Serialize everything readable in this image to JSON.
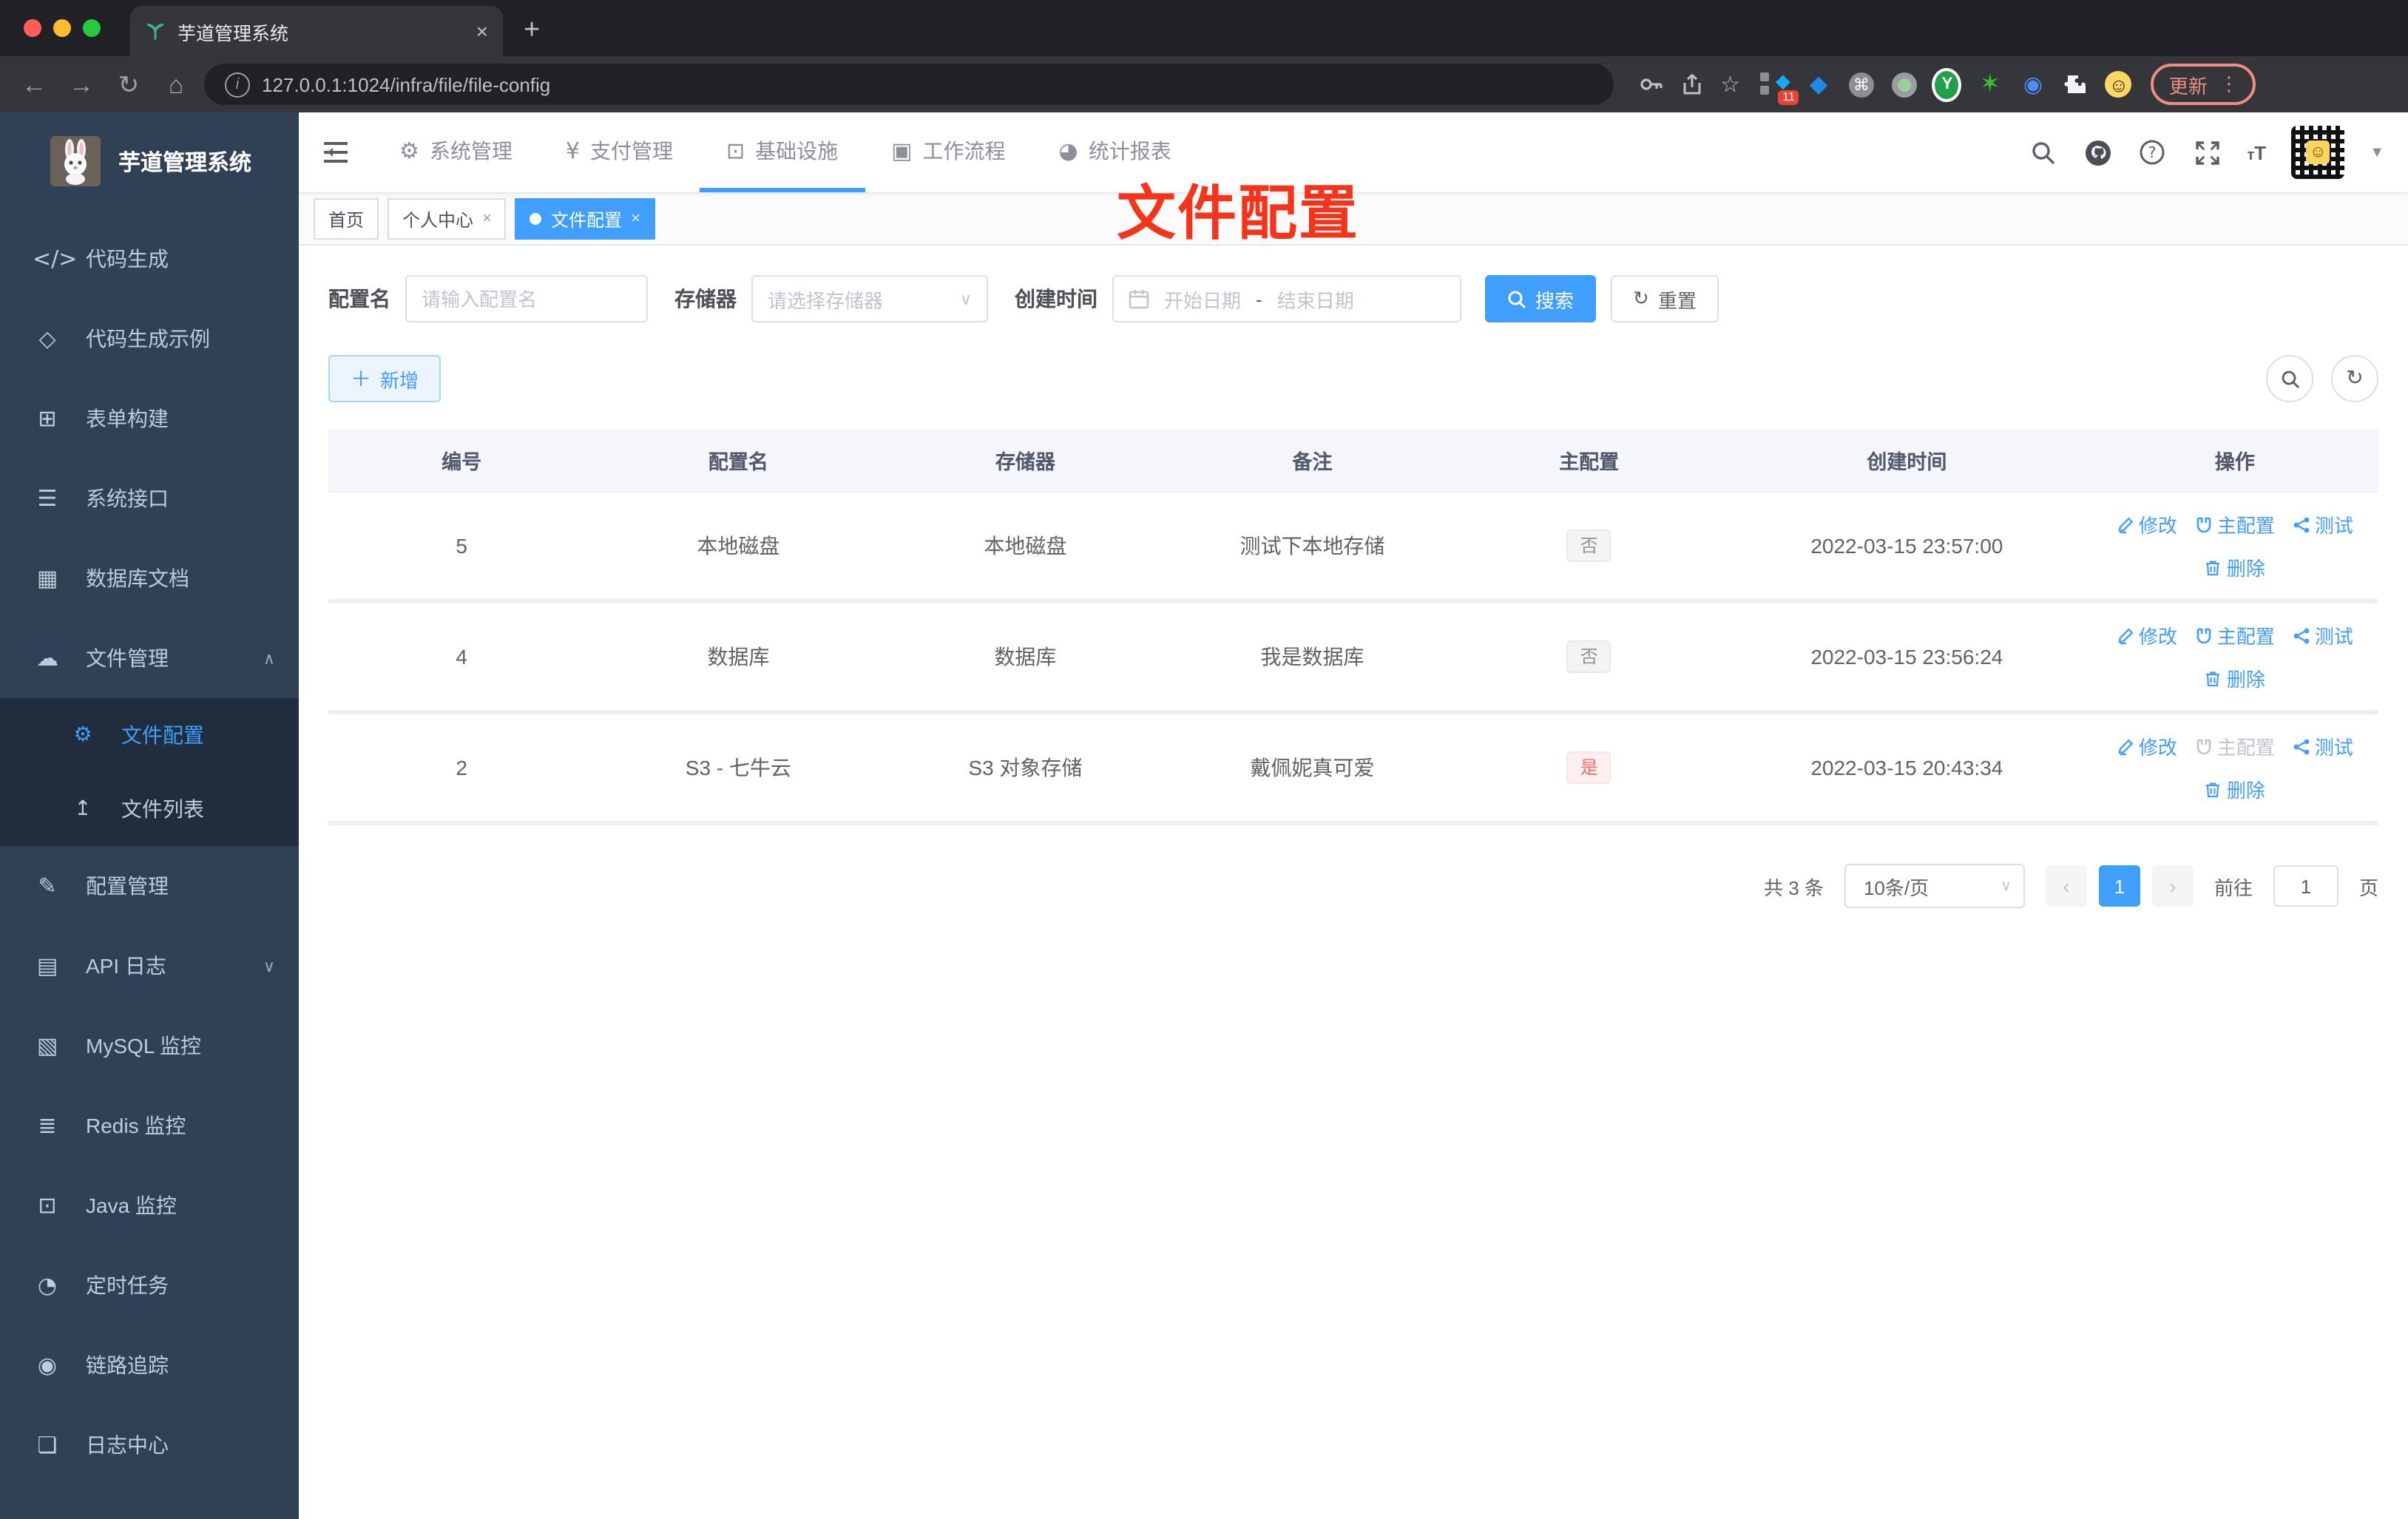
{
  "browser": {
    "tab_title": "芋道管理系统",
    "tab_close": "×",
    "new_tab": "+",
    "url": "127.0.0.1:1024/infra/file/file-config",
    "ext_badge": "11",
    "update_label": "更新",
    "menu_dots": "⋮"
  },
  "app": {
    "brand": "芋道管理系统",
    "overlay_title": "文件配置",
    "topnav": [
      {
        "icon": "gear-icon",
        "label": "系统管理",
        "active": false
      },
      {
        "icon": "yen-icon",
        "label": "支付管理",
        "active": false
      },
      {
        "icon": "monitor-icon",
        "label": "基础设施",
        "active": true
      },
      {
        "icon": "briefcase-icon",
        "label": "工作流程",
        "active": false
      },
      {
        "icon": "dashboard-icon",
        "label": "统计报表",
        "active": false
      }
    ],
    "tabs": [
      {
        "label": "首页",
        "closable": false,
        "active": false
      },
      {
        "label": "个人中心",
        "closable": true,
        "active": false
      },
      {
        "label": "文件配置",
        "closable": true,
        "active": true
      }
    ],
    "tab_close_glyph": "×"
  },
  "sidebar": {
    "items": [
      {
        "icon": "code-icon",
        "label": "代码生成",
        "child": false
      },
      {
        "icon": "shield-icon",
        "label": "代码生成示例",
        "child": false
      },
      {
        "icon": "form-icon",
        "label": "表单构建",
        "child": false
      },
      {
        "icon": "sliders-icon",
        "label": "系统接口",
        "child": false
      },
      {
        "icon": "table-icon",
        "label": "数据库文档",
        "child": false
      },
      {
        "icon": "cloud-download-icon",
        "label": "文件管理",
        "child": false,
        "expand": "up"
      },
      {
        "icon": "gear-icon",
        "label": "文件配置",
        "child": true,
        "active": true
      },
      {
        "icon": "cloud-upload-icon",
        "label": "文件列表",
        "child": true
      },
      {
        "icon": "edit-square-icon",
        "label": "配置管理",
        "child": false
      },
      {
        "icon": "doc-edit-icon",
        "label": "API 日志",
        "child": false,
        "expand": "down"
      },
      {
        "icon": "chart-icon",
        "label": "MySQL 监控",
        "child": false
      },
      {
        "icon": "layers-icon",
        "label": "Redis 监控",
        "child": false
      },
      {
        "icon": "monitor-icon",
        "label": "Java 监控",
        "child": false
      },
      {
        "icon": "timer-icon",
        "label": "定时任务",
        "child": false
      },
      {
        "icon": "eye-icon",
        "label": "链路追踪",
        "child": false
      },
      {
        "icon": "log-icon",
        "label": "日志中心",
        "child": false
      }
    ]
  },
  "filters": {
    "name_label": "配置名",
    "name_placeholder": "请输入配置名",
    "storage_label": "存储器",
    "storage_placeholder": "请选择存储器",
    "date_label": "创建时间",
    "date_start": "开始日期",
    "date_sep": "-",
    "date_end": "结束日期",
    "search_label": "搜索",
    "reset_label": "重置"
  },
  "toolbar": {
    "add_label": "新增"
  },
  "table": {
    "headers": [
      "编号",
      "配置名",
      "存储器",
      "备注",
      "主配置",
      "创建时间",
      "操作"
    ],
    "actions": {
      "edit": "修改",
      "master": "主配置",
      "test": "测试",
      "del": "删除"
    },
    "rows": [
      {
        "id": "5",
        "name": "本地磁盘",
        "storage": "本地磁盘",
        "remark": "测试下本地存储",
        "primary": "否",
        "primary_type": "info",
        "created": "2022-03-15 23:57:00",
        "master_disabled": false
      },
      {
        "id": "4",
        "name": "数据库",
        "storage": "数据库",
        "remark": "我是数据库",
        "primary": "否",
        "primary_type": "info",
        "created": "2022-03-15 23:56:24",
        "master_disabled": false
      },
      {
        "id": "2",
        "name": "S3 - 七牛云",
        "storage": "S3 对象存储",
        "remark": "戴佩妮真可爱",
        "primary": "是",
        "primary_type": "danger",
        "created": "2022-03-15 20:43:34",
        "master_disabled": true
      }
    ]
  },
  "pagination": {
    "total": "共 3 条",
    "page_size": "10条/页",
    "prev": "‹",
    "next": "›",
    "current": "1",
    "goto": "前往",
    "goto_value": "1",
    "page_suffix": "页"
  },
  "colors": {
    "primary": "#409eff",
    "danger": "#f56c6c",
    "sidebar_bg": "#304156",
    "annotation_red": "#f5351b"
  }
}
